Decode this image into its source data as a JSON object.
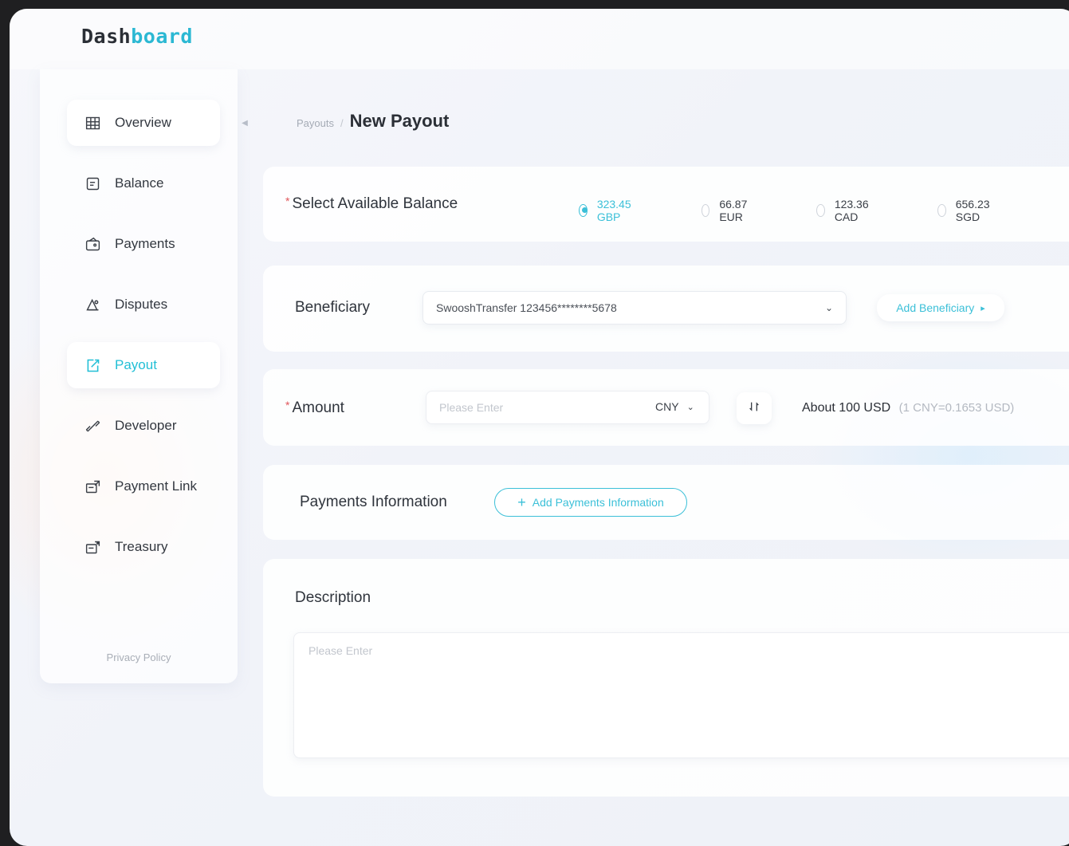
{
  "app": {
    "logo_part1": "Dash",
    "logo_part2": "board"
  },
  "sidebar": {
    "items": [
      {
        "label": "Overview",
        "icon": "grid-icon"
      },
      {
        "label": "Balance",
        "icon": "balance-icon"
      },
      {
        "label": "Payments",
        "icon": "wallet-icon"
      },
      {
        "label": "Disputes",
        "icon": "disputes-icon"
      },
      {
        "label": "Payout",
        "icon": "payout-icon",
        "active": true
      },
      {
        "label": "Developer",
        "icon": "link-chain-icon"
      },
      {
        "label": "Payment Link",
        "icon": "payment-link-icon"
      },
      {
        "label": "Treasury",
        "icon": "treasury-icon"
      }
    ],
    "privacy": "Privacy Policy"
  },
  "breadcrumb": {
    "parent": "Payouts",
    "separator": "/",
    "title": "New Payout"
  },
  "balance": {
    "required_mark": "*",
    "label": "Select Available Balance",
    "options": [
      "323.45 GBP",
      "66.87 EUR",
      "123.36 CAD",
      "656.23 SGD"
    ],
    "selected": "323.45 GBP"
  },
  "beneficiary": {
    "label": "Beneficiary",
    "value": "SwooshTransfer 123456********5678",
    "add_label": "Add Beneficiary"
  },
  "amount": {
    "required_mark": "*",
    "label": "Amount",
    "placeholder": "Please Enter",
    "currency": "CNY",
    "about_prefix": "About",
    "about_value": "100",
    "about_currency": "USD",
    "rate": "(1 CNY=0.1653 USD)"
  },
  "payments_info": {
    "label": "Payments Information",
    "add_label": "Add Payments Information"
  },
  "description": {
    "label": "Description",
    "placeholder": "Please Enter"
  },
  "colors": {
    "accent": "#3cc0d8",
    "text": "#2b2f36",
    "required": "#e0565b"
  }
}
